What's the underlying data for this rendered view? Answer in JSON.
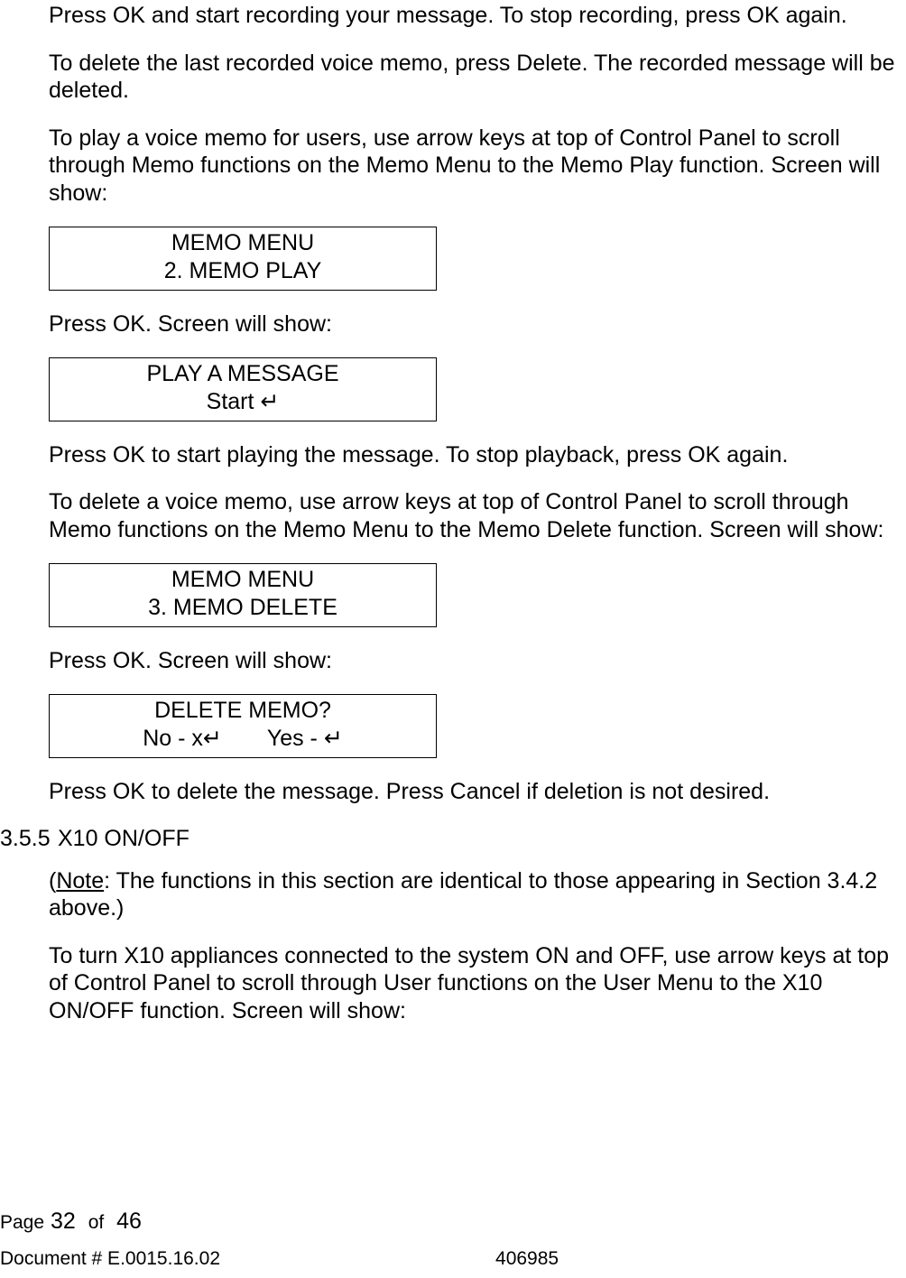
{
  "paragraphs": {
    "p1": "Press OK and start recording your message. To stop recording, press OK again.",
    "p2": "To delete the last recorded voice memo, press Delete. The recorded message will be deleted.",
    "p3": "To play a voice memo for users, use arrow keys at top of Control Panel to scroll through Memo functions on the Memo Menu to the Memo Play function. Screen will show:",
    "p4": "Press OK. Screen will show:",
    "p5": "Press OK to start playing the message. To stop playback, press OK again.",
    "p6": "To delete a voice memo, use arrow keys at top of Control Panel to scroll through Memo functions on the Memo Menu to the Memo Delete function. Screen will show:",
    "p7": "Press OK. Screen will show:",
    "p8": "Press OK to delete the message. Press Cancel if deletion is not desired.",
    "p9a": "Note",
    "p9b": ": The functions in this section are identical to those appearing in Section 3.4.2 above.)",
    "p10": "To turn X10 appliances connected to the system ON and OFF, use arrow keys at top of Control Panel to scroll through User functions on the User Menu to the X10 ON/OFF function. Screen will show:"
  },
  "lcd": {
    "box1": {
      "l1": "MEMO MENU",
      "l2": "2. MEMO PLAY"
    },
    "box2": {
      "l1": "PLAY A MESSAGE",
      "l2": "Start ↵"
    },
    "box3": {
      "l1": "MEMO MENU",
      "l2": "3. MEMO DELETE"
    },
    "box4": {
      "l1": "DELETE MEMO?",
      "l2a": "No - x↵",
      "l2b": "Yes - ↵"
    }
  },
  "section": {
    "num": "3.5.5",
    "title": "X10 ON/OFF"
  },
  "footer": {
    "page_label": "Page",
    "page_cur": "32",
    "page_of": "of",
    "page_total": "46",
    "doc_label": "Document # E.0015.16.02",
    "doc_code": "406985"
  }
}
